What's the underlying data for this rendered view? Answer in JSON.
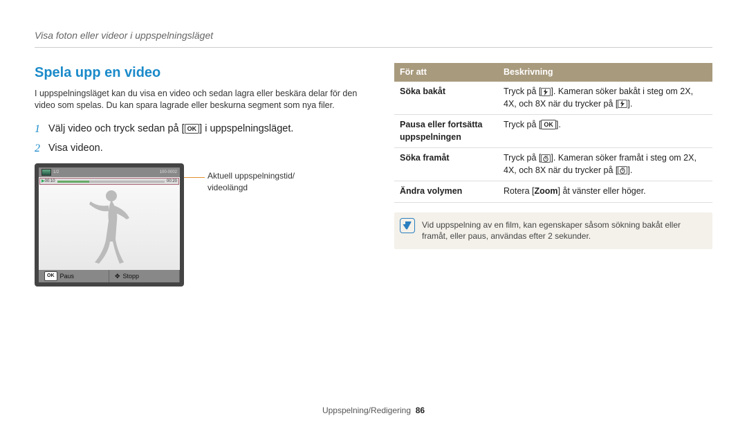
{
  "header": "Visa foton eller videor i uppspelningsläget",
  "section_title": "Spela upp en video",
  "intro": "I uppspelningsläget kan du visa en video och sedan lagra eller beskära delar för den video som spelas. Du kan spara lagrade eller beskurna segment som nya filer.",
  "steps": {
    "s1_pre": "Välj video och tryck sedan på [",
    "s1_btn": "OK",
    "s1_post": "] i uppspelningsläget.",
    "s2": "Visa videon."
  },
  "figure": {
    "top_count": "1/2",
    "top_right": "100-0002",
    "time_left": "00:10",
    "time_right": "00:20",
    "footer_left": "Paus",
    "footer_right": "Stopp"
  },
  "callout": "Aktuell uppspelningstid/\nvideolängd",
  "table": {
    "header_left": "För att",
    "header_right": "Beskrivning",
    "rows": [
      {
        "label": "Söka bakåt",
        "desc_parts": [
          "Tryck på [",
          "flash-icon",
          "]. Kameran söker bakåt i steg om 2X, 4X, och 8X när du trycker på [",
          "flash-icon",
          "]."
        ]
      },
      {
        "label": "Pausa eller fortsätta uppspelningen",
        "desc_parts": [
          "Tryck på [",
          "OK",
          "]."
        ]
      },
      {
        "label": "Söka framåt",
        "desc_parts": [
          "Tryck på [",
          "timer-icon",
          "]. Kameran söker framåt i steg om 2X, 4X, och 8X när du trycker på [",
          "timer-icon",
          "]."
        ]
      },
      {
        "label": "Ändra volymen",
        "desc_plain_pre": "Rotera [",
        "desc_bold": "Zoom",
        "desc_plain_post": "] åt vänster eller höger."
      }
    ]
  },
  "note": "Vid uppspelning av en film, kan egenskaper såsom sökning bakåt eller framåt, eller paus, användas efter 2 sekunder.",
  "footer": {
    "section": "Uppspelning/Redigering",
    "page": "86"
  }
}
